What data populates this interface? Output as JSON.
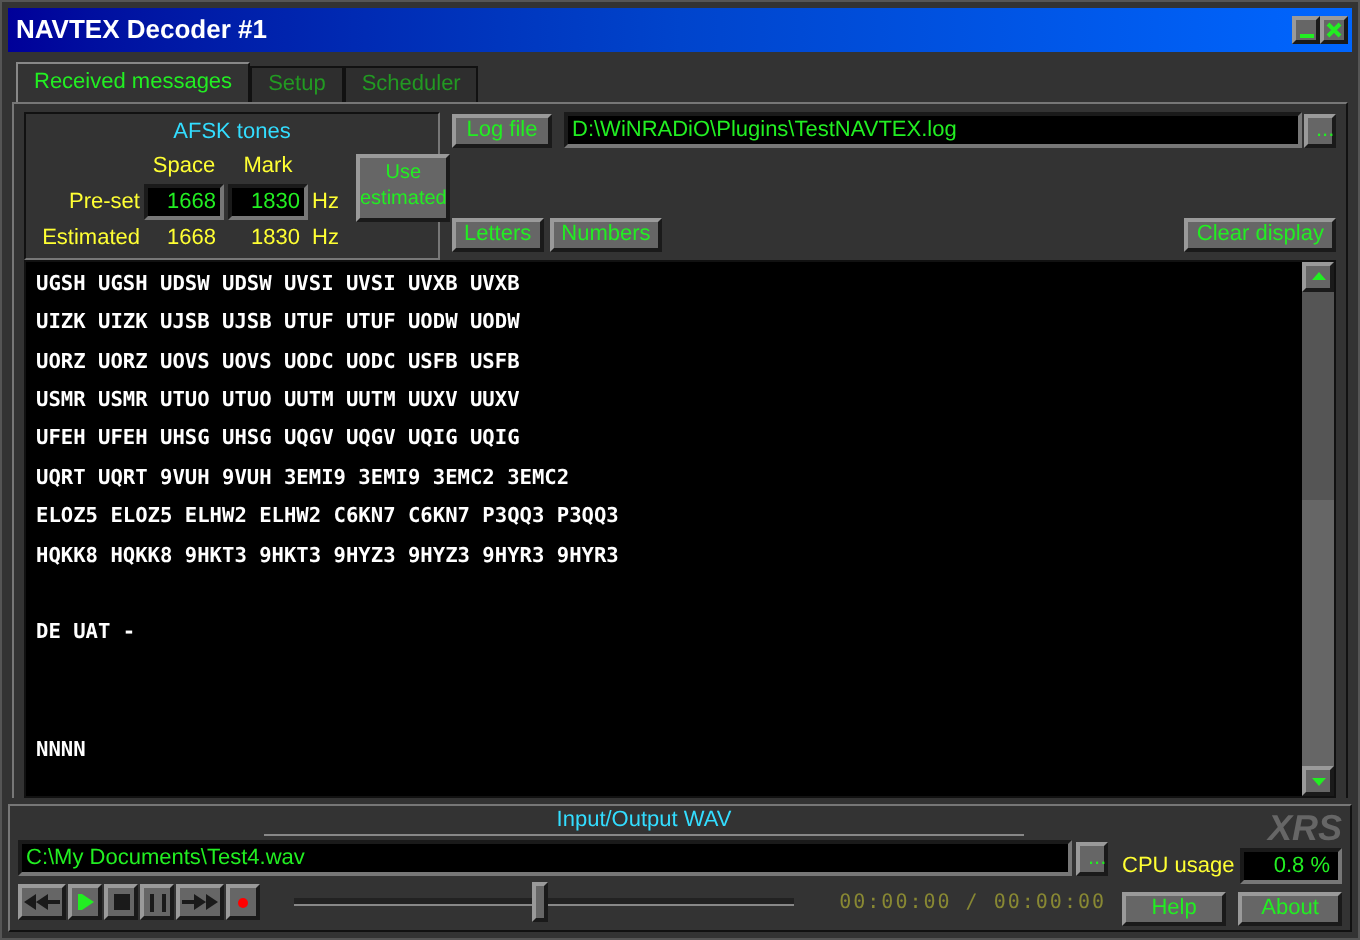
{
  "window": {
    "title": "NAVTEX Decoder #1"
  },
  "tabs": [
    {
      "label": "Received messages",
      "selected": true
    },
    {
      "label": "Setup",
      "selected": false
    },
    {
      "label": "Scheduler",
      "selected": false
    }
  ],
  "afsk": {
    "title": "AFSK tones",
    "space_label": "Space",
    "mark_label": "Mark",
    "preset_label": "Pre-set",
    "preset_space": "1668",
    "preset_mark": "1830",
    "preset_unit": "Hz",
    "estimated_label": "Estimated",
    "estimated_space": "1668",
    "estimated_mark": "1830",
    "estimated_unit": "Hz",
    "use_button": "Use estimated"
  },
  "log": {
    "button": "Log file",
    "path": "D:\\WiNRADiO\\Plugins\\TestNAVTEX.log",
    "browse": "..."
  },
  "shift_buttons": [
    "Letters",
    "Numbers"
  ],
  "clear_button": "Clear display",
  "messages": [
    {
      "kind": "plain",
      "lines": [
        "UGSH UGSH UDSW UDSW UVSI UVSI UVXB UVXB",
        "UIZK UIZK UJSB UJSB UTUF UTUF UODW UODW",
        "UORZ UORZ UOVS UOVS UODC UODC USFB USFB",
        "USMR USMR UTUO UTUO UUTM UUTM UUXV UUXV",
        "UFEH UFEH UHSG UHSG UQGV UQGV UQIG UQIG",
        "UQRT UQRT 9VUH 9VUH 3EMI9 3EMI9 3EMC2 3EMC2",
        "ELOZ5 ELOZ5 ELHW2 ELHW2 C6KN7 C6KN7 P3QQ3 P3QQ3",
        "HQKK8 HQKK8 9HKT3 9HKT3 9HYZ3 9HYZ3 9HYR3 9HYR3"
      ]
    },
    {
      "kind": "spaced",
      "lines": [
        "DE UAT -"
      ]
    },
    {
      "kind": "double-spaced",
      "lines": [
        "NNNN"
      ]
    }
  ],
  "wav": {
    "title": "Input/Output WAV",
    "path": "C:\\My Documents\\Test4.wav",
    "browse": "...",
    "position": {
      "level": 0.49
    },
    "time": "00:00:00 / 00:00:00"
  },
  "transport": [
    {
      "kind": "prev"
    },
    {
      "kind": "play"
    },
    {
      "kind": "stop"
    },
    {
      "kind": "pause"
    },
    {
      "kind": "next"
    },
    {
      "kind": "record"
    }
  ],
  "logo": "XRS",
  "cpu": {
    "label": "CPU usage",
    "value": "0.8 %"
  },
  "bottom_buttons": [
    "Help",
    "About"
  ]
}
